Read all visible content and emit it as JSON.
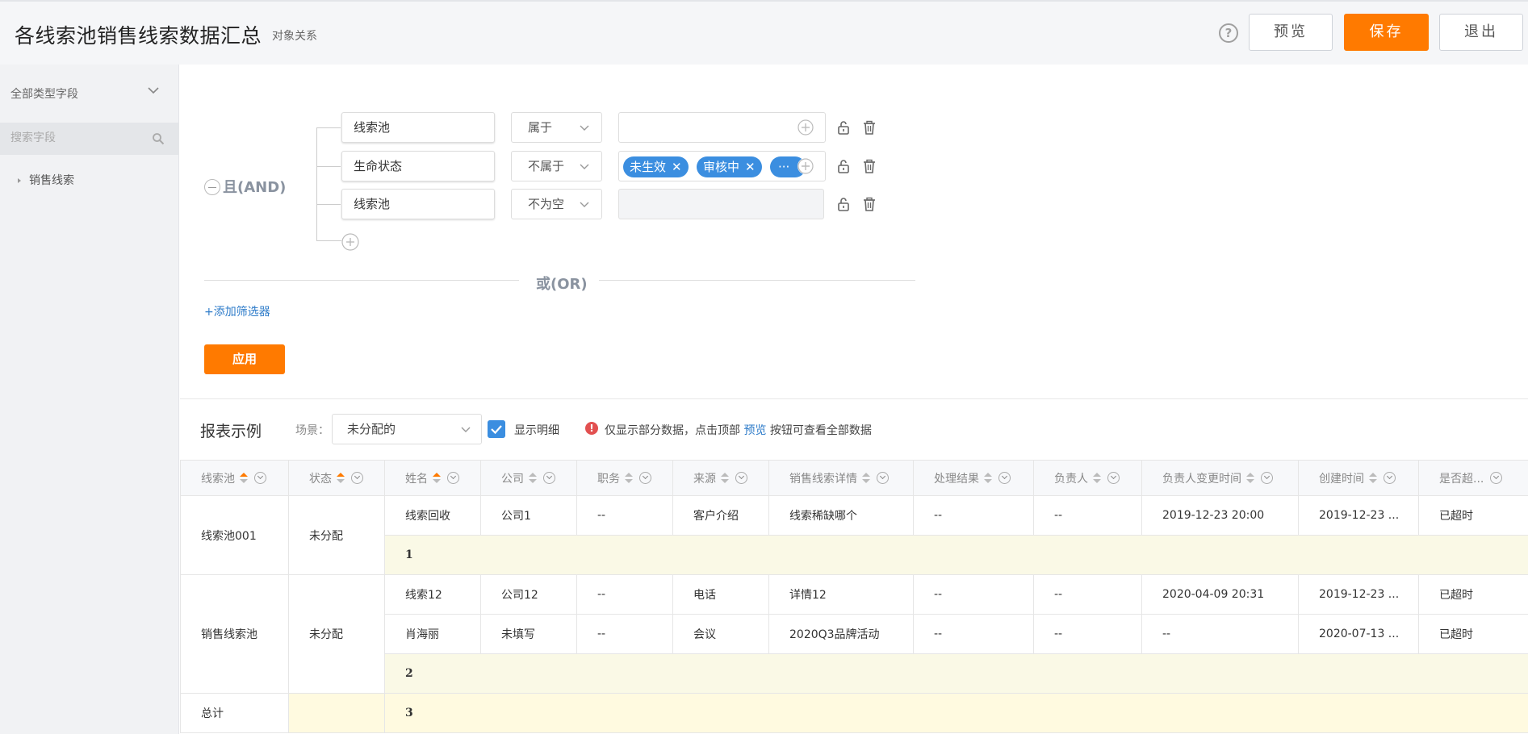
{
  "header": {
    "title": "各线索池销售线索数据汇总",
    "subtitle": "对象关系",
    "preview_label": "预览",
    "save_label": "保存",
    "exit_label": "退出",
    "help_glyph": "?"
  },
  "sidebar": {
    "field_type_label": "全部类型字段",
    "search_placeholder": "搜索字段",
    "tree_items": [
      "销售线索"
    ]
  },
  "filter": {
    "and_label": "且(AND)",
    "or_label": "或(OR)",
    "add_filter_label": "+添加筛选器",
    "apply_label": "应用",
    "conditions": [
      {
        "field": "线索池",
        "operator": "属于",
        "values": []
      },
      {
        "field": "生命状态",
        "operator": "不属于",
        "values": [
          "未生效",
          "审核中"
        ],
        "more": "···"
      },
      {
        "field": "线索池",
        "operator": "不为空",
        "values": []
      }
    ]
  },
  "report": {
    "title": "报表示例",
    "scene_label": "场景：",
    "scene_value": "未分配的",
    "show_detail_label": "显示明细",
    "show_detail_checked": true,
    "notice_before": "仅显示部分数据，点击顶部",
    "notice_link": "预览",
    "notice_after": "按钮可查看全部数据",
    "columns": [
      "线索池",
      "状态",
      "姓名",
      "公司",
      "职务",
      "来源",
      "销售线索详情",
      "处理结果",
      "负责人",
      "负责人变更时间",
      "创建时间",
      "是否超..."
    ],
    "groups": [
      {
        "pool": "线索池001",
        "status": "未分配",
        "rows": [
          [
            "线索回收",
            "公司1",
            "--",
            "客户介绍",
            "线索稀缺哪个",
            "--",
            "--",
            "2019-12-23 20:00",
            "2019-12-23 ...",
            "已超时"
          ]
        ],
        "subtotal": "1"
      },
      {
        "pool": "销售线索池",
        "status": "未分配",
        "rows": [
          [
            "线索12",
            "公司12",
            "--",
            "电话",
            "详情12",
            "--",
            "--",
            "2020-04-09 20:31",
            "2019-12-23 ...",
            "已超时"
          ],
          [
            "肖海丽",
            "未填写",
            "--",
            "会议",
            "2020Q3品牌活动",
            "--",
            "--",
            "--",
            "2020-07-13 ...",
            "已超时"
          ]
        ],
        "subtotal": "2"
      }
    ],
    "total_label": "总计",
    "total_value": "3"
  },
  "colors": {
    "accent": "#ff7a00",
    "link": "#2d7bc9",
    "tag": "#3b8ee0"
  }
}
